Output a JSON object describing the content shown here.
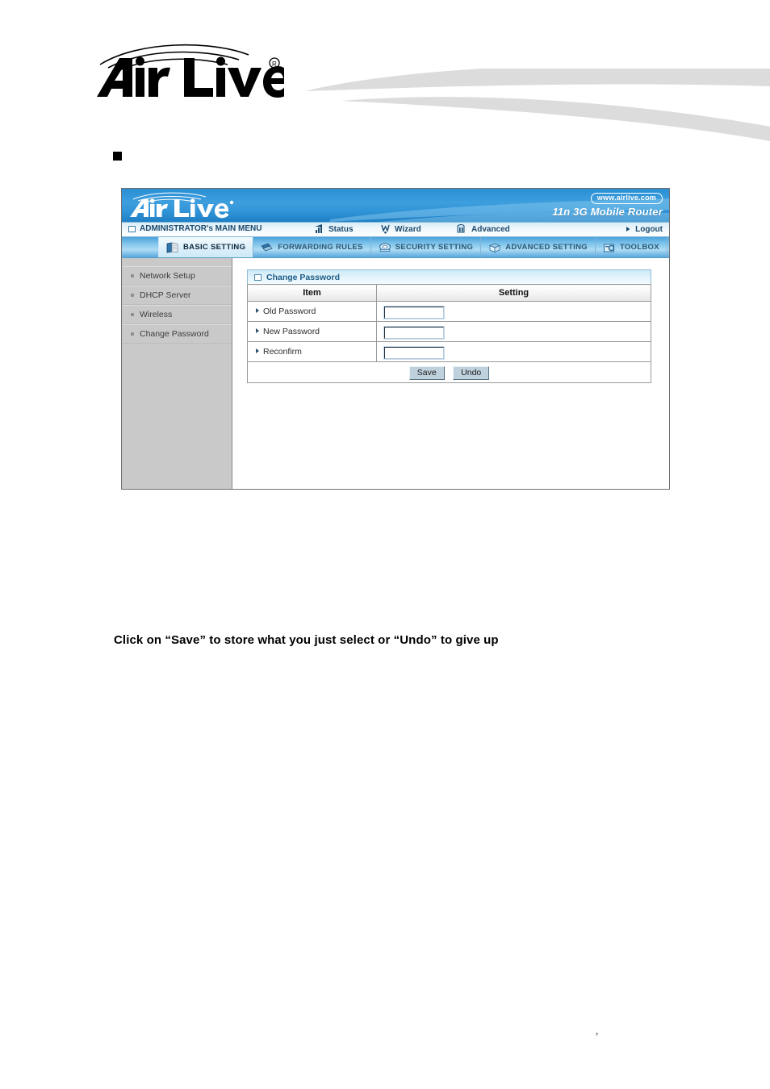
{
  "document": {
    "brand": "AirLive",
    "brand_registered_mark": "®",
    "section_bullet_label": "",
    "caption": "Click on “Save” to store what you just select or “Undo” to give up",
    "stray_mark": ","
  },
  "router_ui": {
    "banner": {
      "logo_text": "AirLive",
      "website_badge": "www.airlive.com",
      "model_name": "11n 3G Mobile Router"
    },
    "admin_strip": {
      "main_menu_label": "ADMINISTRATOR's MAIN MENU",
      "items": [
        {
          "label": "Status",
          "icon": "signal-bars-icon"
        },
        {
          "label": "Wizard",
          "icon": "wand-icon"
        },
        {
          "label": "Advanced",
          "icon": "sliders-icon"
        },
        {
          "label": "Logout",
          "icon": "arrow-right-icon"
        }
      ]
    },
    "tabs": [
      {
        "label": "BASIC SETTING",
        "icon": "book-icon",
        "active": true
      },
      {
        "label": "FORWARDING RULES",
        "icon": "arrows-icon",
        "active": false
      },
      {
        "label": "SECURITY SETTING",
        "icon": "shield-icon",
        "active": false
      },
      {
        "label": "ADVANCED SETTING",
        "icon": "box-icon",
        "active": false
      },
      {
        "label": "TOOLBOX",
        "icon": "tools-icon",
        "active": false
      }
    ],
    "sidebar": {
      "items": [
        {
          "label": "Network Setup"
        },
        {
          "label": "DHCP Server"
        },
        {
          "label": "Wireless"
        },
        {
          "label": "Change Password"
        }
      ]
    },
    "panel": {
      "title": "Change Password",
      "columns": {
        "item": "Item",
        "setting": "Setting"
      },
      "rows": [
        {
          "label": "Old Password",
          "value": "",
          "placeholder": ""
        },
        {
          "label": "New Password",
          "value": "",
          "placeholder": ""
        },
        {
          "label": "Reconfirm",
          "value": "",
          "placeholder": ""
        }
      ],
      "buttons": {
        "save": "Save",
        "undo": "Undo"
      }
    }
  },
  "colors": {
    "banner_blue": "#3e9ede",
    "tab_blue": "#7cc2ea",
    "sidebar_gray": "#c9c9c9",
    "panel_title_blue": "#cdeaf7",
    "swoosh_gray": "#dcdcdc"
  }
}
